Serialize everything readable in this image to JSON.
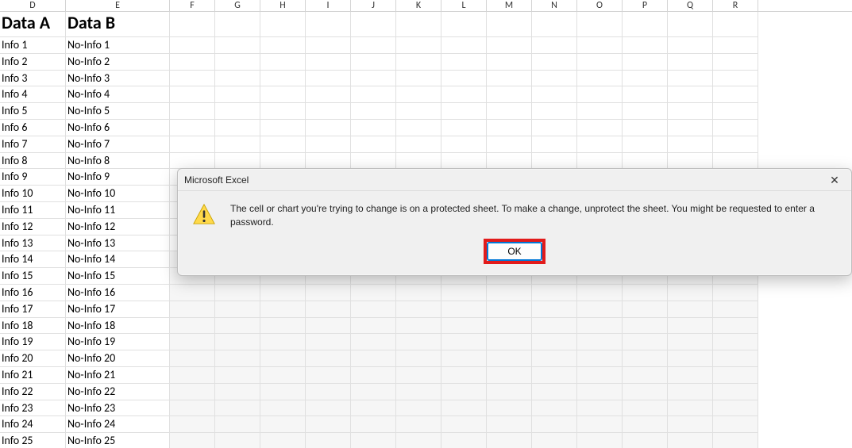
{
  "columns": [
    "D",
    "E",
    "F",
    "G",
    "H",
    "I",
    "J",
    "K",
    "L",
    "M",
    "N",
    "O",
    "P",
    "Q",
    "R"
  ],
  "headerRow": {
    "d": "Data A",
    "e": "Data B"
  },
  "rows": [
    {
      "d": "Info 1",
      "e": "No-Info 1"
    },
    {
      "d": "Info 2",
      "e": "No-Info 2"
    },
    {
      "d": "Info 3",
      "e": "No-Info 3"
    },
    {
      "d": "Info 4",
      "e": "No-Info 4"
    },
    {
      "d": "Info 5",
      "e": "No-Info 5"
    },
    {
      "d": "Info 6",
      "e": "No-Info 6"
    },
    {
      "d": "Info 7",
      "e": "No-Info 7"
    },
    {
      "d": "Info 8",
      "e": "No-Info 8"
    },
    {
      "d": "Info 9",
      "e": "No-Info 9"
    },
    {
      "d": "Info 10",
      "e": "No-Info 10"
    },
    {
      "d": "Info 11",
      "e": "No-Info 11"
    },
    {
      "d": "Info 12",
      "e": "No-Info 12"
    },
    {
      "d": "Info 13",
      "e": "No-Info 13"
    },
    {
      "d": "Info 14",
      "e": "No-Info 14"
    },
    {
      "d": "Info 15",
      "e": "No-Info 15"
    },
    {
      "d": "Info 16",
      "e": "No-Info 16"
    },
    {
      "d": "Info 17",
      "e": "No-Info 17"
    },
    {
      "d": "Info 18",
      "e": "No-Info 18"
    },
    {
      "d": "Info 19",
      "e": "No-Info 19"
    },
    {
      "d": "Info 20",
      "e": "No-Info 20"
    },
    {
      "d": "Info 21",
      "e": "No-Info 21"
    },
    {
      "d": "Info 22",
      "e": "No-Info 22"
    },
    {
      "d": "Info 23",
      "e": "No-Info 23"
    },
    {
      "d": "Info 24",
      "e": "No-Info 24"
    },
    {
      "d": "Info 25",
      "e": "No-Info 25"
    }
  ],
  "shadedRowsFrom": 14,
  "dialog": {
    "title": "Microsoft Excel",
    "close_label": "✕",
    "message": "The cell or chart you're trying to change is on a protected sheet. To make a change, unprotect the sheet. You might be requested to enter a password.",
    "ok_label": "OK"
  }
}
